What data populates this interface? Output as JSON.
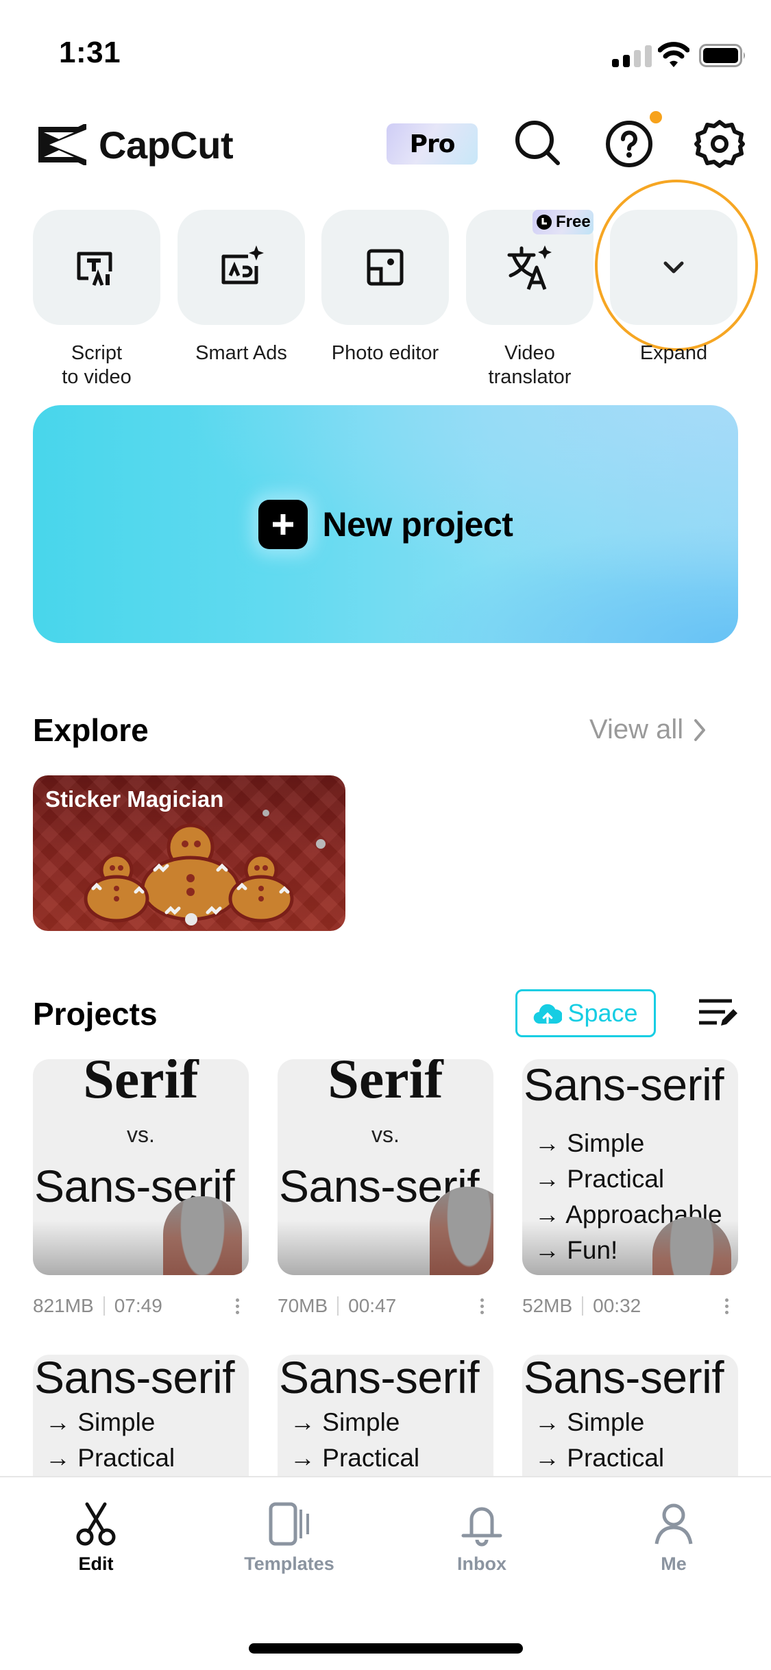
{
  "status_bar": {
    "time": "1:31",
    "signal_bars_filled": 2,
    "signal_bars_total": 4,
    "wifi_icon": "wifi-icon",
    "battery_icon": "battery-full-icon"
  },
  "header": {
    "brand": "CapCut",
    "pro_badge": "Pro",
    "icons": [
      "search-icon",
      "help-icon",
      "settings-gear-icon"
    ],
    "help_has_notification": true,
    "accent_colors": {
      "notification_dot": "#f7a21b"
    }
  },
  "tools": [
    {
      "id": "script-to-video",
      "label": "Script\nto video",
      "icon": "script-ai-icon"
    },
    {
      "id": "smart-ads",
      "label": "Smart Ads",
      "icon": "ads-sparkle-icon"
    },
    {
      "id": "photo-editor",
      "label": "Photo editor",
      "icon": "photo-editor-icon"
    },
    {
      "id": "video-translator",
      "label": "Video\ntranslator",
      "icon": "translate-icon",
      "badge": "Free"
    },
    {
      "id": "expand",
      "label": "Expand",
      "icon": "chevron-down-icon",
      "highlighted": true
    }
  ],
  "new_project": {
    "label": "New project",
    "icon": "plus-icon"
  },
  "explore": {
    "title": "Explore",
    "view_all": "View all",
    "cards": [
      {
        "title": "Sticker Magician"
      }
    ]
  },
  "projects": {
    "title": "Projects",
    "space_button": "Space",
    "space_color": "#16cde3",
    "items": [
      {
        "thumb_lines": [
          "Serif",
          "vs.",
          "Sans-serif"
        ],
        "size": "821MB",
        "duration": "07:49"
      },
      {
        "thumb_lines": [
          "Serif",
          "vs.",
          "Sans-serif"
        ],
        "size": "70MB",
        "duration": "00:47"
      },
      {
        "thumb_lines": [
          "Sans-serif",
          "→ Simple",
          "→ Practical",
          "→ Approachable",
          "→ Fun!"
        ],
        "size": "52MB",
        "duration": "00:32"
      },
      {
        "thumb_lines": [
          "Sans-serif",
          "→ Simple",
          "→ Practical"
        ]
      },
      {
        "thumb_lines": [
          "Sans-serif",
          "→ Simple",
          "→ Practical"
        ]
      },
      {
        "thumb_lines": [
          "Sans-serif",
          "→ Simple",
          "→ Practical"
        ]
      }
    ]
  },
  "bottom_nav": {
    "items": [
      {
        "label": "Edit",
        "icon": "scissors-icon",
        "active": true
      },
      {
        "label": "Templates",
        "icon": "templates-icon",
        "active": false
      },
      {
        "label": "Inbox",
        "icon": "bell-icon",
        "active": false
      },
      {
        "label": "Me",
        "icon": "person-icon",
        "active": false
      }
    ]
  }
}
